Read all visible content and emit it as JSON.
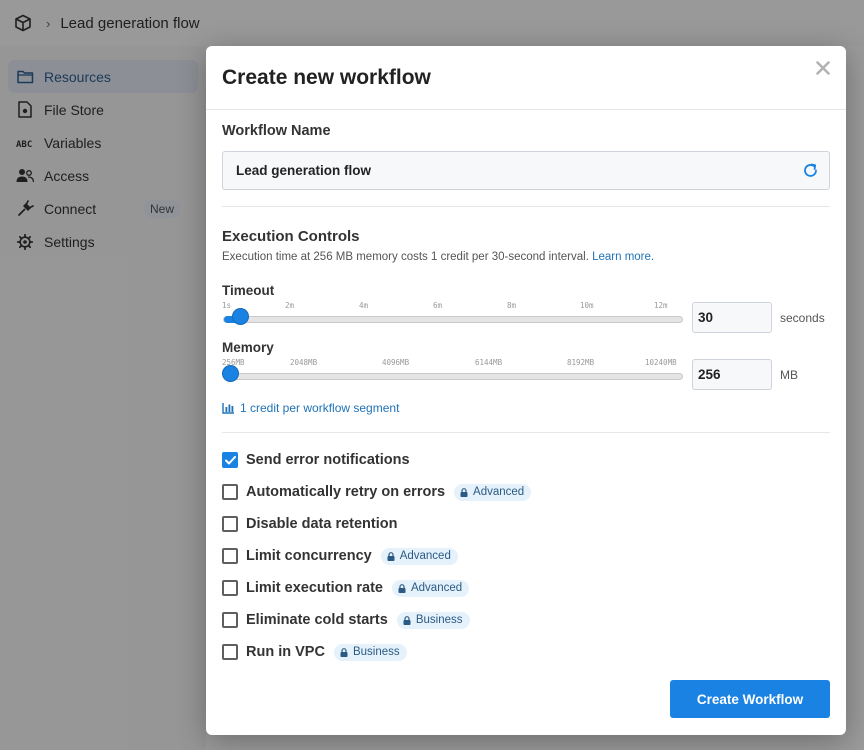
{
  "topbar": {
    "breadcrumb": "Lead generation flow",
    "logo_icon": "cube-icon"
  },
  "sidebar": {
    "items": [
      {
        "label": "Resources",
        "icon": "folder-icon",
        "active": true
      },
      {
        "label": "File Store",
        "icon": "file-icon"
      },
      {
        "label": "Variables",
        "icon": "abc-icon"
      },
      {
        "label": "Access",
        "icon": "users-icon"
      },
      {
        "label": "Connect",
        "icon": "plug-icon",
        "badge": "New"
      },
      {
        "label": "Settings",
        "icon": "gear-icon"
      }
    ]
  },
  "modal": {
    "title": "Create new workflow",
    "name_label": "Workflow Name",
    "name_value": "Lead generation flow",
    "exec_title": "Execution Controls",
    "exec_desc": "Execution time at 256 MB memory costs 1 credit per 30-second interval.",
    "exec_link": "Learn more.",
    "timeout": {
      "label": "Timeout",
      "ticks": [
        "1s",
        "2m",
        "4m",
        "6m",
        "8m",
        "10m",
        "12m"
      ],
      "value": "30",
      "unit": "seconds",
      "fraction": 0.04
    },
    "memory": {
      "label": "Memory",
      "ticks": [
        "256MB",
        "2048MB",
        "4096MB",
        "6144MB",
        "8192MB",
        "10240MB"
      ],
      "value": "256",
      "unit": "MB",
      "fraction": 0
    },
    "credit_note": "1 credit per workflow segment",
    "options": [
      {
        "label": "Send error notifications",
        "checked": true
      },
      {
        "label": "Automatically retry on errors",
        "checked": false,
        "tag": "Advanced"
      },
      {
        "label": "Disable data retention",
        "checked": false
      },
      {
        "label": "Limit concurrency",
        "checked": false,
        "tag": "Advanced"
      },
      {
        "label": "Limit execution rate",
        "checked": false,
        "tag": "Advanced"
      },
      {
        "label": "Eliminate cold starts",
        "checked": false,
        "tag": "Business"
      },
      {
        "label": "Run in VPC",
        "checked": false,
        "tag": "Business"
      }
    ],
    "create_label": "Create Workflow"
  },
  "colors": {
    "accent": "#1a82e2",
    "link": "#1f73b7",
    "tag_bg": "#e6f2fb"
  }
}
